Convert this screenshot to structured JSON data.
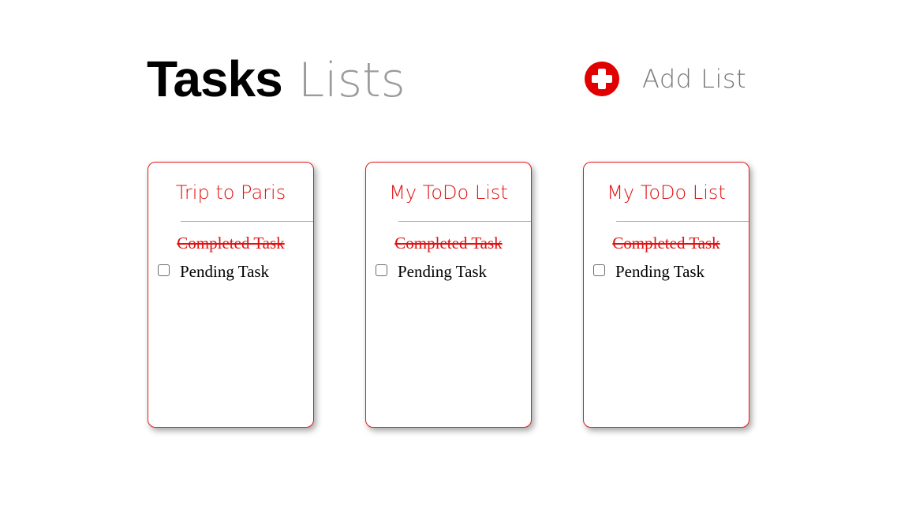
{
  "header": {
    "title_bold": "Tasks",
    "title_light": "Lists",
    "add_list_label": "Add List",
    "add_icon": "plus-circle-icon"
  },
  "colors": {
    "accent": "#e00000",
    "card_border": "#e21b1b",
    "title_light": "#8a8a8a"
  },
  "lists": [
    {
      "title": "Trip to Paris",
      "completed_task": "Completed Task",
      "pending_task": "Pending Task",
      "pending_checked": false
    },
    {
      "title": "My ToDo List",
      "completed_task": "Completed Task",
      "pending_task": "Pending Task",
      "pending_checked": false
    },
    {
      "title": "My ToDo List",
      "completed_task": "Completed Task",
      "pending_task": "Pending Task",
      "pending_checked": false
    }
  ]
}
